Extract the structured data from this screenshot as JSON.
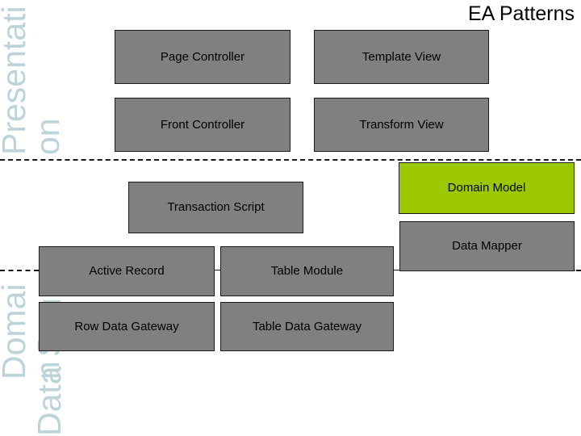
{
  "slide": {
    "title": "EA Patterns",
    "background_color": "#ffffff",
    "box_fill_color": "#808080",
    "box_highlight_color": "#9cc800",
    "box_border_color": "#1a1a1a",
    "layer_label_color": "#bcd4d8"
  },
  "layers": [
    {
      "id": "presentation",
      "label": "Presentati\non"
    },
    {
      "id": "domain",
      "label": "Domai\nn"
    },
    {
      "id": "data-source",
      "label": "Data Source"
    }
  ],
  "patterns": [
    {
      "id": "page-controller",
      "label": "Page Controller",
      "layer": "presentation",
      "highlight": false
    },
    {
      "id": "template-view",
      "label": "Template View",
      "layer": "presentation",
      "highlight": false
    },
    {
      "id": "front-controller",
      "label": "Front Controller",
      "layer": "presentation",
      "highlight": false
    },
    {
      "id": "transform-view",
      "label": "Transform View",
      "layer": "presentation",
      "highlight": false
    },
    {
      "id": "transaction-script",
      "label": "Transaction Script",
      "layer": "domain",
      "highlight": false
    },
    {
      "id": "domain-model",
      "label": "Domain Model",
      "layer": "domain",
      "highlight": true
    },
    {
      "id": "data-mapper",
      "label": "Data Mapper",
      "layer": "data-source",
      "highlight": false
    },
    {
      "id": "active-record",
      "label": "Active Record",
      "layer": "data-source",
      "highlight": false
    },
    {
      "id": "table-module",
      "label": "Table Module",
      "layer": "domain",
      "highlight": false
    },
    {
      "id": "row-data-gateway",
      "label": "Row Data Gateway",
      "layer": "data-source",
      "highlight": false
    },
    {
      "id": "table-data-gateway",
      "label": "Table Data Gateway",
      "layer": "data-source",
      "highlight": false
    }
  ]
}
